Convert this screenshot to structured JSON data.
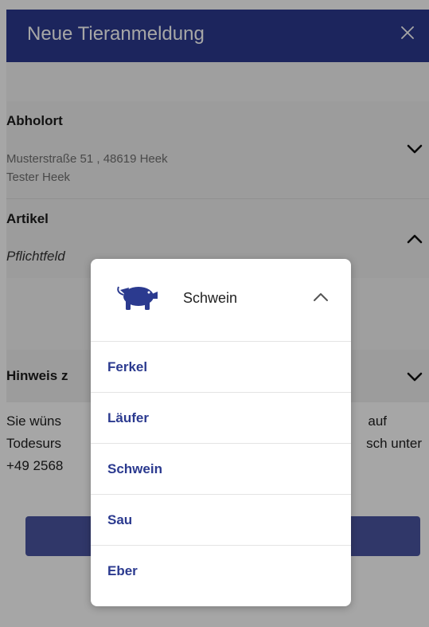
{
  "header": {
    "title": "Neue Tieranmeldung",
    "close_icon": "close-icon"
  },
  "abholort": {
    "title": "Abholort",
    "address_line1": "Musterstraße 51 , 48619 Heek",
    "address_line2": "Tester Heek",
    "toggle_icon": "chevron-down-icon"
  },
  "artikel": {
    "title": "Artikel",
    "placeholder": "Pflichtfeld",
    "toggle_icon": "chevron-up-icon"
  },
  "hinweis": {
    "title": "Hinweis z",
    "toggle_icon": "chevron-down-icon"
  },
  "note": {
    "line1_left": "Sie wüns",
    "line1_right": "auf",
    "line2_left": "Todesurs",
    "line2_right": "sch unter",
    "line3_left": "+49 2568"
  },
  "dropdown": {
    "selected_icon": "pig-icon",
    "selected_label": "Schwein",
    "toggle_icon": "chevron-up-icon",
    "options": [
      "Ferkel",
      "Läufer",
      "Schwein",
      "Sau",
      "Eber"
    ]
  },
  "colors": {
    "header_bg": "#2b3a8f",
    "accent": "#2b3a8f",
    "button_bg": "#4a55a2"
  }
}
